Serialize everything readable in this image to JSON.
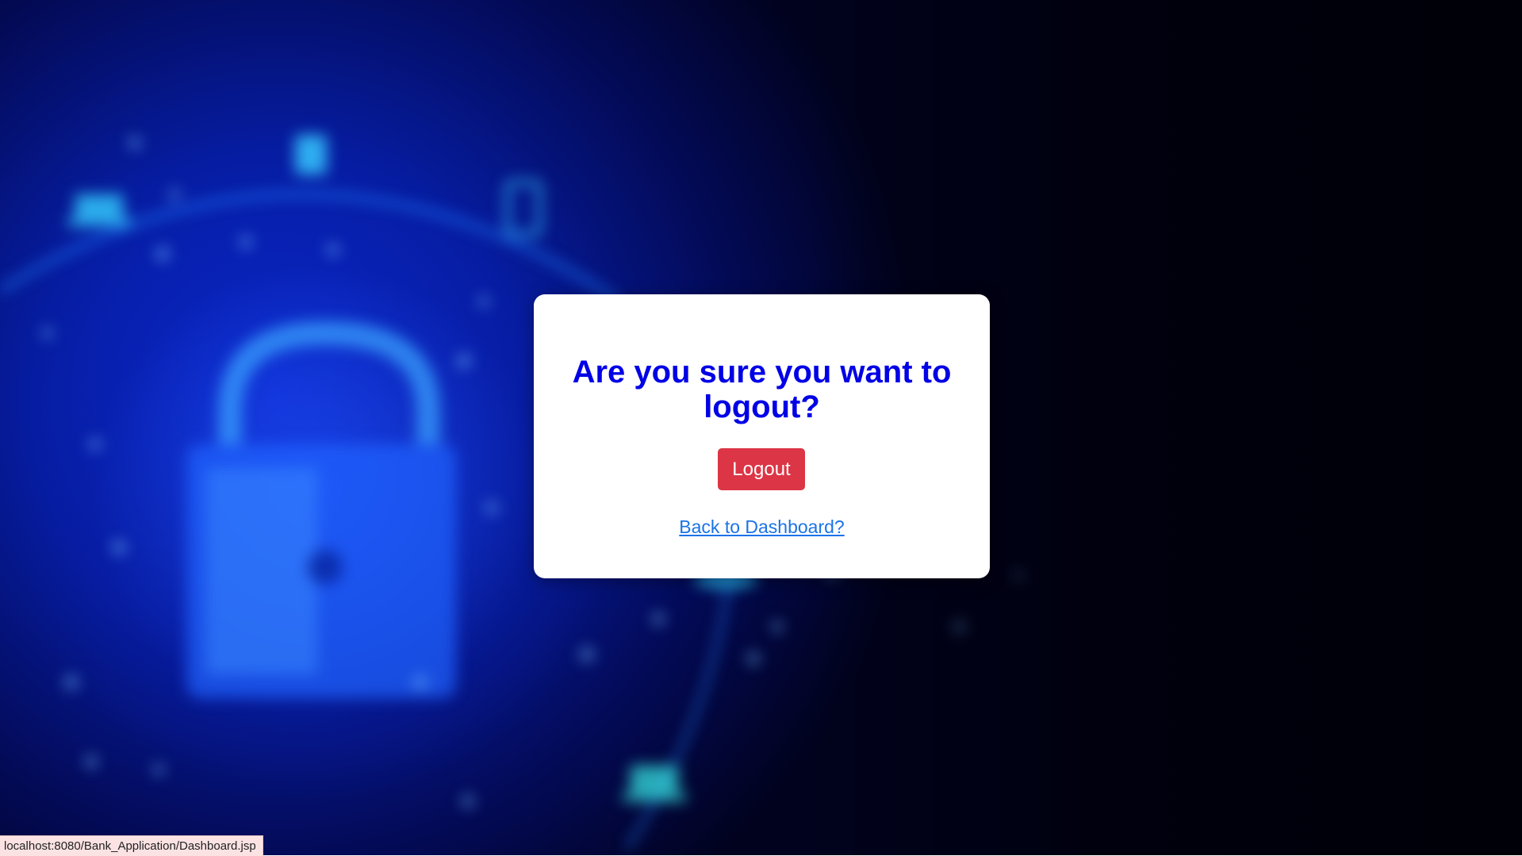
{
  "dialog": {
    "heading": "Are you sure you want to logout?",
    "logout_label": "Logout",
    "back_link_label": "Back to Dashboard?"
  },
  "status_bar": {
    "url": "localhost:8080/Bank_Application/Dashboard.jsp"
  },
  "background": {
    "description_icons": [
      "padlock-icon",
      "laptop-icon",
      "lock-icon"
    ],
    "primary_color": "#0a2bd6",
    "dark_color": "#00010f"
  },
  "colors": {
    "heading": "#0000e6",
    "logout_button": "#dc3545",
    "link": "#1a73e8"
  }
}
